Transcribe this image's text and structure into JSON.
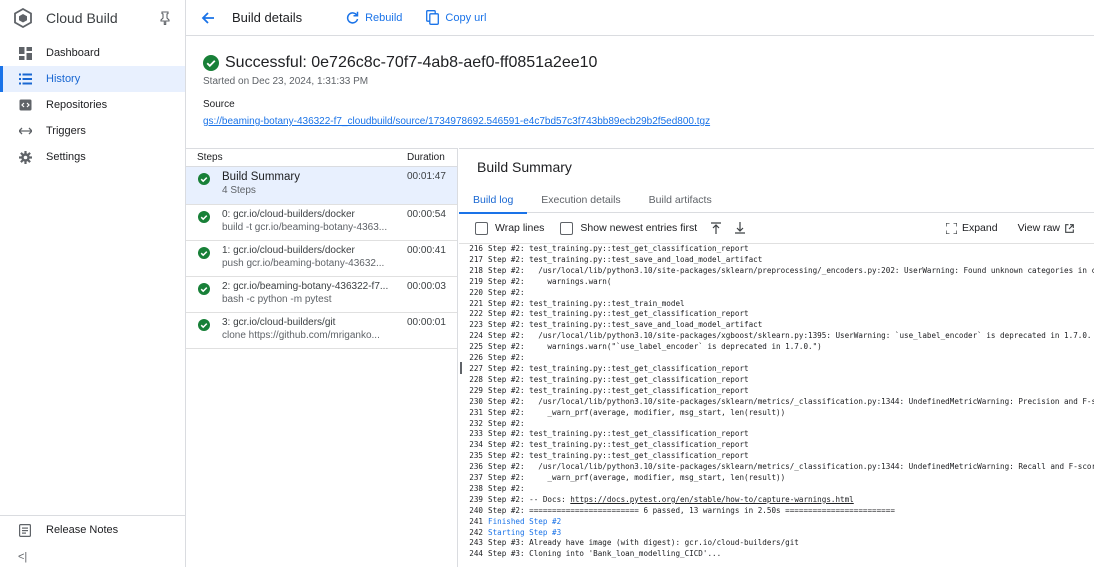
{
  "app": {
    "title": "Cloud Build"
  },
  "sidebar": {
    "items": [
      {
        "label": "Dashboard",
        "icon": "dashboard-icon"
      },
      {
        "label": "History",
        "icon": "history-list-icon"
      },
      {
        "label": "Repositories",
        "icon": "repositories-icon"
      },
      {
        "label": "Triggers",
        "icon": "triggers-icon"
      },
      {
        "label": "Settings",
        "icon": "settings-gear-icon"
      }
    ],
    "active": "History",
    "release_notes": "Release Notes",
    "collapse_glyph": "<|"
  },
  "header": {
    "title": "Build details",
    "rebuild_label": "Rebuild",
    "copy_url_label": "Copy url"
  },
  "build": {
    "status_title": "Successful: 0e726c8c-70f7-4ab8-aef0-ff0851a2ee10",
    "started": "Started on Dec 23, 2024, 1:31:33 PM",
    "source_label": "Source",
    "source_link": "gs://beaming-botany-436322-f7_cloudbuild/source/1734978692.546591-e4c7bd57c3f743bb89ecb29b2f5ed800.tgz"
  },
  "steps": {
    "header_steps": "Steps",
    "header_duration": "Duration",
    "rows": [
      {
        "name": "Build Summary",
        "sub": "4 Steps",
        "duration": "00:01:47"
      },
      {
        "name": "0: gcr.io/cloud-builders/docker",
        "sub": "build -t gcr.io/beaming-botany-4363...",
        "duration": "00:00:54"
      },
      {
        "name": "1: gcr.io/cloud-builders/docker",
        "sub": "push gcr.io/beaming-botany-43632...",
        "duration": "00:00:41"
      },
      {
        "name": "2: gcr.io/beaming-botany-436322-f7...",
        "sub": "bash -c python -m pytest",
        "duration": "00:00:03"
      },
      {
        "name": "3: gcr.io/cloud-builders/git",
        "sub": "clone https://github.com/mriganko...",
        "duration": "00:00:01"
      }
    ]
  },
  "log_panel": {
    "title": "Build Summary",
    "tabs": [
      "Build log",
      "Execution details",
      "Build artifacts"
    ],
    "wrap_lines": "Wrap lines",
    "show_newest": "Show newest entries first",
    "expand": "Expand",
    "view_raw": "View raw"
  },
  "log_lines": [
    {
      "n": "216",
      "t": "Step #2: test_training.py::test_get_classification_report"
    },
    {
      "n": "217",
      "t": "Step #2: test_training.py::test_save_and_load_model_artifact"
    },
    {
      "n": "218",
      "t": "Step #2:   /usr/local/lib/python3.10/site-packages/sklearn/preprocessing/_encoders.py:202: UserWarning: Found unknown categories in columns"
    },
    {
      "n": "219",
      "t": "Step #2:     warnings.warn("
    },
    {
      "n": "220",
      "t": "Step #2:"
    },
    {
      "n": "221",
      "t": "Step #2: test_training.py::test_train_model"
    },
    {
      "n": "222",
      "t": "Step #2: test_training.py::test_get_classification_report"
    },
    {
      "n": "223",
      "t": "Step #2: test_training.py::test_save_and_load_model_artifact"
    },
    {
      "n": "224",
      "t": "Step #2:   /usr/local/lib/python3.10/site-packages/xgboost/sklearn.py:1395: UserWarning: `use_label_encoder` is deprecated in 1.7.0."
    },
    {
      "n": "225",
      "t": "Step #2:     warnings.warn(\"`use_label_encoder` is deprecated in 1.7.0.\")"
    },
    {
      "n": "226",
      "t": "Step #2:"
    },
    {
      "n": "227",
      "t": "Step #2: test_training.py::test_get_classification_report"
    },
    {
      "n": "228",
      "t": "Step #2: test_training.py::test_get_classification_report"
    },
    {
      "n": "229",
      "t": "Step #2: test_training.py::test_get_classification_report"
    },
    {
      "n": "230",
      "t": "Step #2:   /usr/local/lib/python3.10/site-packages/sklearn/metrics/_classification.py:1344: UndefinedMetricWarning: Precision and F-score are"
    },
    {
      "n": "231",
      "t": "Step #2:     _warn_prf(average, modifier, msg_start, len(result))"
    },
    {
      "n": "232",
      "t": "Step #2:"
    },
    {
      "n": "233",
      "t": "Step #2: test_training.py::test_get_classification_report"
    },
    {
      "n": "234",
      "t": "Step #2: test_training.py::test_get_classification_report"
    },
    {
      "n": "235",
      "t": "Step #2: test_training.py::test_get_classification_report"
    },
    {
      "n": "236",
      "t": "Step #2:   /usr/local/lib/python3.10/site-packages/sklearn/metrics/_classification.py:1344: UndefinedMetricWarning: Recall and F-score are"
    },
    {
      "n": "237",
      "t": "Step #2:     _warn_prf(average, modifier, msg_start, len(result))"
    },
    {
      "n": "238",
      "t": "Step #2:"
    },
    {
      "n": "239",
      "t": "Step #2: -- Docs: https://docs.pytest.org/en/stable/how-to/capture-warnings.html"
    },
    {
      "n": "240",
      "t": "Step #2: ======================== 6 passed, 13 warnings in 2.50s ========================"
    },
    {
      "n": "241",
      "t": "Finished Step #2",
      "style": "blue"
    },
    {
      "n": "242",
      "t": "Starting Step #3",
      "style": "blue"
    },
    {
      "n": "243",
      "t": "Step #3: Already have image (with digest): gcr.io/cloud-builders/git"
    },
    {
      "n": "244",
      "t": "Step #3: Cloning into 'Bank_loan_modelling_CICD'..."
    }
  ],
  "colors": {
    "accent": "#1a73e8",
    "success": "#188038",
    "active_bg": "#e8f0fe"
  }
}
